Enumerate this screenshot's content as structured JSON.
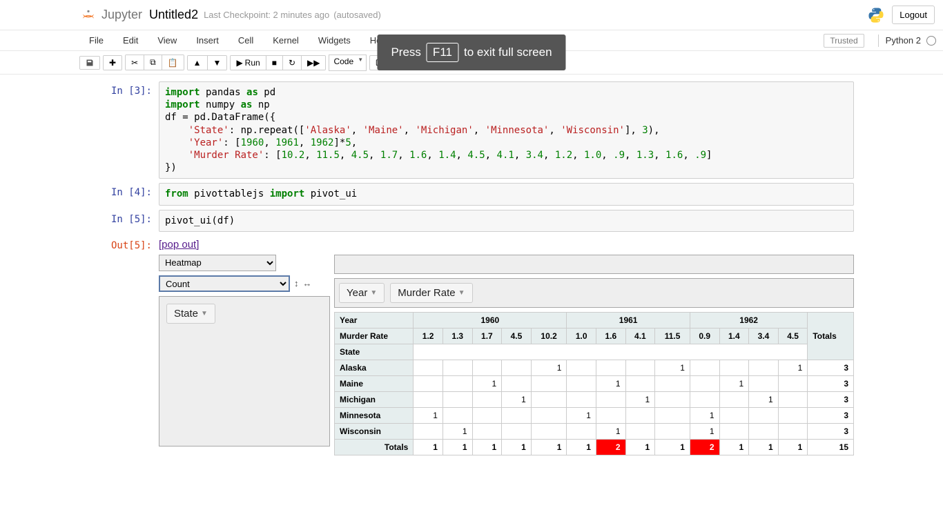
{
  "header": {
    "logo_text": "Jupyter",
    "title": "Untitled2",
    "checkpoint": "Last Checkpoint: 2 minutes ago",
    "autosaved": "(autosaved)",
    "logout": "Logout"
  },
  "menubar": {
    "items": [
      "File",
      "Edit",
      "View",
      "Insert",
      "Cell",
      "Kernel",
      "Widgets",
      "Help"
    ],
    "trusted": "Trusted",
    "kernel": "Python 2"
  },
  "toolbar": {
    "run_label": "Run",
    "cell_type": "Code"
  },
  "fullscreen_msg": {
    "press": "Press",
    "key": "F11",
    "exit": "to exit full screen"
  },
  "cells": {
    "c0": {
      "prompt": "In [3]:",
      "code_html": "<span class='k'>import</span> pandas <span class='k'>as</span> pd\n<span class='k'>import</span> numpy <span class='k'>as</span> np\ndf = pd.DataFrame({\n    <span class='s'>'State'</span>: np.repeat([<span class='s'>'Alaska'</span>, <span class='s'>'Maine'</span>, <span class='s'>'Michigan'</span>, <span class='s'>'Minnesota'</span>, <span class='s'>'Wisconsin'</span>], <span class='num'>3</span>),\n    <span class='s'>'Year'</span>: [<span class='num'>1960</span>, <span class='num'>1961</span>, <span class='num'>1962</span>]*<span class='num'>5</span>,\n    <span class='s'>'Murder Rate'</span>: [<span class='num'>10.2</span>, <span class='num'>11.5</span>, <span class='num'>4.5</span>, <span class='num'>1.7</span>, <span class='num'>1.6</span>, <span class='num'>1.4</span>, <span class='num'>4.5</span>, <span class='num'>4.1</span>, <span class='num'>3.4</span>, <span class='num'>1.2</span>, <span class='num'>1.0</span>, <span class='num'>.9</span>, <span class='num'>1.3</span>, <span class='num'>1.6</span>, <span class='num'>.9</span>]\n})"
    },
    "c1": {
      "prompt": "In [4]:",
      "code_html": "<span class='k'>from</span> pivottablejs <span class='k'>import</span> pivot_ui"
    },
    "c2": {
      "prompt": "In [5]:",
      "code_html": "pivot_ui(df)"
    },
    "out": {
      "prompt": "Out[5]:",
      "popout": "[pop out]"
    }
  },
  "pivot": {
    "renderer": "Heatmap",
    "aggregator": "Count",
    "row_fields": [
      "State"
    ],
    "col_fields": [
      "Year",
      "Murder Rate"
    ],
    "arrows": {
      "ud": "↕",
      "lr": "↔"
    }
  },
  "chart_data": {
    "type": "table",
    "col_groups": [
      {
        "year": "1960",
        "rates": [
          "1.2",
          "1.3",
          "1.7",
          "4.5",
          "10.2"
        ]
      },
      {
        "year": "1961",
        "rates": [
          "1.0",
          "1.6",
          "4.1",
          "11.5"
        ]
      },
      {
        "year": "1962",
        "rates": [
          "0.9",
          "1.4",
          "3.4",
          "4.5"
        ]
      }
    ],
    "headers": {
      "year": "Year",
      "murder": "Murder Rate",
      "state": "State",
      "totals": "Totals"
    },
    "rows": [
      {
        "state": "Alaska",
        "cells": [
          "",
          "",
          "",
          "",
          "1",
          "",
          "",
          "",
          "1",
          "",
          "",
          "",
          "1"
        ],
        "total": "3"
      },
      {
        "state": "Maine",
        "cells": [
          "",
          "",
          "1",
          "",
          "",
          "",
          "1",
          "",
          "",
          "",
          "1",
          "",
          ""
        ],
        "total": "3"
      },
      {
        "state": "Michigan",
        "cells": [
          "",
          "",
          "",
          "1",
          "",
          "",
          "",
          "1",
          "",
          "",
          "",
          "1",
          ""
        ],
        "total": "3"
      },
      {
        "state": "Minnesota",
        "cells": [
          "1",
          "",
          "",
          "",
          "",
          "1",
          "",
          "",
          "",
          "1",
          "",
          "",
          ""
        ],
        "total": "3"
      },
      {
        "state": "Wisconsin",
        "cells": [
          "",
          "1",
          "",
          "",
          "",
          "",
          "1",
          "",
          "",
          "1",
          "",
          "",
          ""
        ],
        "total": "3"
      }
    ],
    "col_totals": [
      "1",
      "1",
      "1",
      "1",
      "1",
      "1",
      "2",
      "1",
      "1",
      "2",
      "1",
      "1",
      "1"
    ],
    "grand_total": "15"
  }
}
